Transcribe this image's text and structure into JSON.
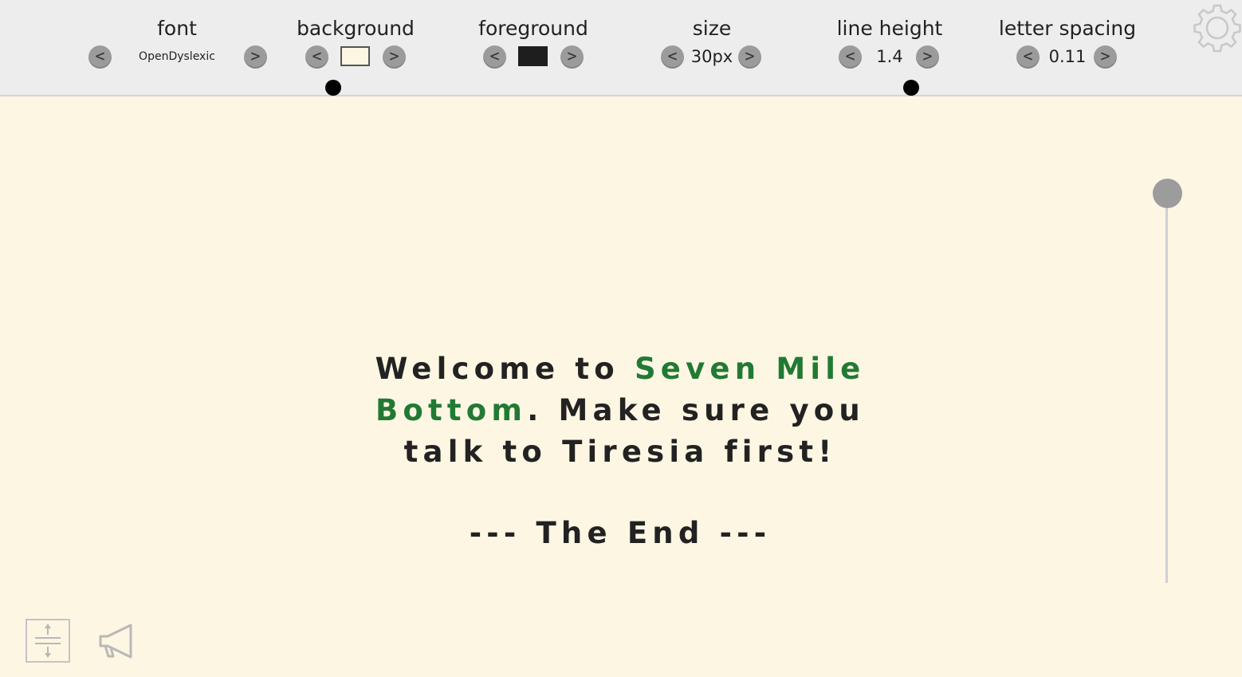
{
  "toolbar": {
    "font": {
      "label": "font",
      "value": "OpenDyslexic",
      "prev": "<",
      "next": ">"
    },
    "background": {
      "label": "background",
      "swatch_color": "#fdf6e3",
      "prev": "<",
      "next": ">"
    },
    "foreground": {
      "label": "foreground",
      "swatch_color": "#1e1e1e",
      "prev": "<",
      "next": ">"
    },
    "size": {
      "label": "size",
      "value": "30px",
      "prev": "<",
      "next": ">"
    },
    "line_height": {
      "label": "line height",
      "value": "1.4",
      "prev": "<",
      "next": ">"
    },
    "letter_spacing": {
      "label": "letter spacing",
      "value": "0.11",
      "prev": "<",
      "next": ">"
    },
    "settings_icon": "gear-icon"
  },
  "content": {
    "intro": "Welcome to ",
    "place_name": "Seven Mile Bottom",
    "rest": ". Make sure you talk to Tiresia first!",
    "end_text": "--- The End ---"
  },
  "colors": {
    "page_background": "#fdf6e3",
    "text": "#222222",
    "highlight": "#217a33",
    "toolbar_background": "#ededed"
  },
  "controls": {
    "line_focus_icon": "line-spacing-icon",
    "speak_icon": "megaphone-icon",
    "scroll_slider_icon": "vertical-slider"
  }
}
